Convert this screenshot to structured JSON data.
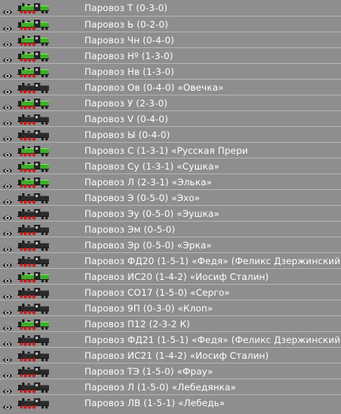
{
  "colors": {
    "background": "#8e8e8e",
    "row_divider": "#b4b4b4",
    "text": "#ffffff",
    "eye_icon": "#1c1c1c"
  },
  "items": [
    {
      "label": "Паровоз Т (0-3-0)",
      "icon": "locomotive-icon",
      "livery": "green"
    },
    {
      "label": "Паровоз Ь (0-2-0)",
      "icon": "locomotive-icon",
      "livery": "green"
    },
    {
      "label": "Паровоз Чн (0-4-0)",
      "icon": "locomotive-icon",
      "livery": "green"
    },
    {
      "label": "Паровоз Нº (1-3-0)",
      "icon": "locomotive-icon",
      "livery": "green"
    },
    {
      "label": "Паровоз Нв (1-3-0)",
      "icon": "locomotive-icon",
      "livery": "green"
    },
    {
      "label": "Паровоз Ов (0-4-0) «Овечка»",
      "icon": "locomotive-icon",
      "livery": "black"
    },
    {
      "label": "Паровоз У (2-3-0)",
      "icon": "locomotive-icon",
      "livery": "green"
    },
    {
      "label": "Паровоз V (0-4-0)",
      "icon": "locomotive-icon",
      "livery": "black"
    },
    {
      "label": "Паровоз Ы (0-4-0)",
      "icon": "locomotive-icon",
      "livery": "black"
    },
    {
      "label": "Паровоз С (1-3-1) «Русская Прери",
      "icon": "locomotive-icon",
      "livery": "green"
    },
    {
      "label": "Паровоз Су (1-3-1) «Сушка»",
      "icon": "locomotive-icon",
      "livery": "green"
    },
    {
      "label": "Паровоз Л (2-3-1) «Элька»",
      "icon": "locomotive-icon",
      "livery": "green"
    },
    {
      "label": "Паровоз Э (0-5-0) «Эхо»",
      "icon": "locomotive-icon",
      "livery": "black"
    },
    {
      "label": "Паровоз Эу (0-5-0) «Эушка»",
      "icon": "locomotive-icon",
      "livery": "black"
    },
    {
      "label": "Паровоз Эм (0-5-0)",
      "icon": "locomotive-icon",
      "livery": "black"
    },
    {
      "label": "Паровоз Эр (0-5-0) «Эрка»",
      "icon": "locomotive-icon",
      "livery": "black"
    },
    {
      "label": "Паровоз ФД20 (1-5-1) «Федя» (Феликс Дзержинский)",
      "icon": "locomotive-icon",
      "livery": "black"
    },
    {
      "label": "Паровоз ИС20 (1-4-2) «Иосиф Сталин)",
      "icon": "locomotive-icon",
      "livery": "green"
    },
    {
      "label": "Паровоз СО17 (1-5-0) «Серго»",
      "icon": "locomotive-icon",
      "livery": "black"
    },
    {
      "label": "Паровоз 9П (0-3-0) «Клоп»",
      "icon": "locomotive-icon",
      "livery": "black"
    },
    {
      "label": "Паровоз П12 (2-3-2 К)",
      "icon": "locomotive-icon",
      "livery": "green"
    },
    {
      "label": "Паровоз ФД21 (1-5-1) «Федя» (Феликс Дзержинский)",
      "icon": "locomotive-icon",
      "livery": "black"
    },
    {
      "label": "Паровоз ИС21 (1-4-2) «Иосиф Сталин)",
      "icon": "locomotive-icon",
      "livery": "black"
    },
    {
      "label": "Паровоз ТЭ (1-5-0) «Фрау»",
      "icon": "locomotive-icon",
      "livery": "black"
    },
    {
      "label": "Паровоз Л (1-5-0) «Лебедянка»",
      "icon": "locomotive-icon",
      "livery": "black"
    },
    {
      "label": "Паровоз ЛВ (1-5-1) «Лебедь»",
      "icon": "locomotive-icon",
      "livery": "black"
    }
  ]
}
